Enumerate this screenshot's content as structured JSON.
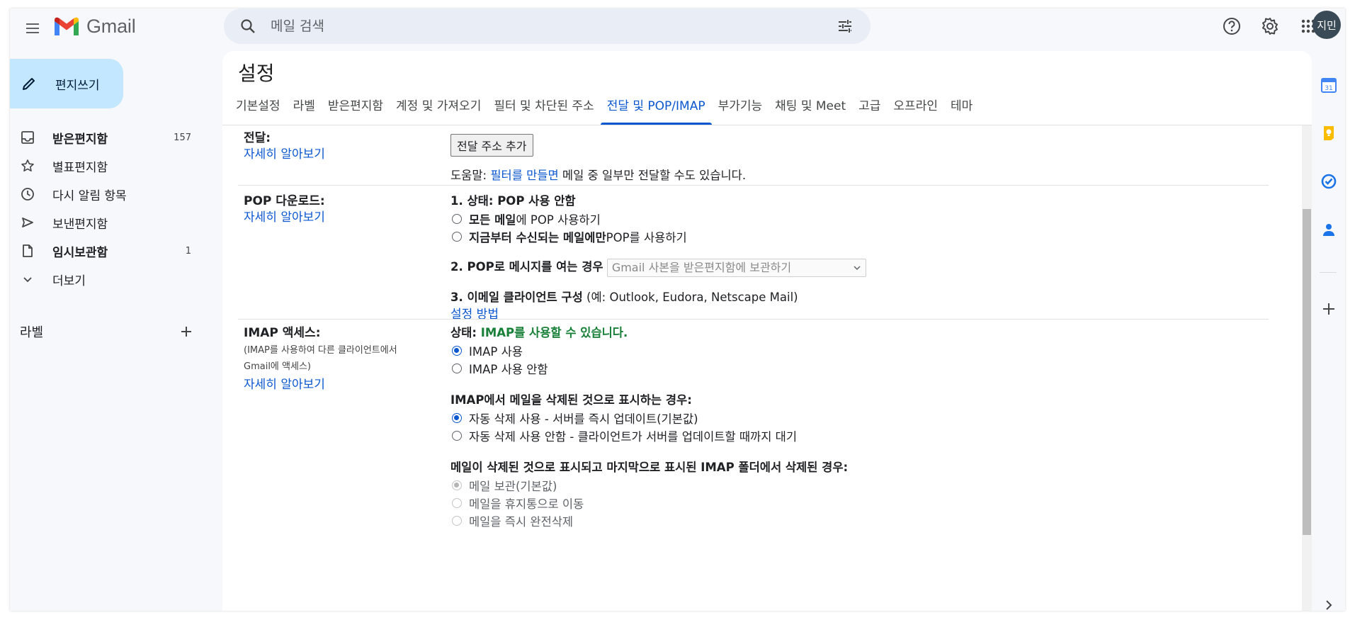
{
  "header": {
    "app_name": "Gmail",
    "search_placeholder": "메일 검색",
    "avatar_text": "지민"
  },
  "sidebar": {
    "compose_label": "편지쓰기",
    "items": [
      {
        "label": "받은편지함",
        "count": "157",
        "icon": "inbox-icon",
        "bold": true
      },
      {
        "label": "별표편지함",
        "count": "",
        "icon": "star-icon",
        "bold": false
      },
      {
        "label": "다시 알림 항목",
        "count": "",
        "icon": "clock-icon",
        "bold": false
      },
      {
        "label": "보낸편지함",
        "count": "",
        "icon": "send-icon",
        "bold": false
      },
      {
        "label": "임시보관함",
        "count": "1",
        "icon": "draft-icon",
        "bold": true
      },
      {
        "label": "더보기",
        "count": "",
        "icon": "chevron-down-icon",
        "bold": false
      }
    ],
    "labels_title": "라벨"
  },
  "main": {
    "title": "설정",
    "tabs": [
      "기본설정",
      "라벨",
      "받은편지함",
      "계정 및 가져오기",
      "필터 및 차단된 주소",
      "전달 및 POP/IMAP",
      "부가기능",
      "채팅 및 Meet",
      "고급",
      "오프라인",
      "테마"
    ],
    "active_tab": "전달 및 POP/IMAP"
  },
  "forwarding": {
    "title": "전달:",
    "learn_more": "자세히 알아보기",
    "add_button": "전달 주소 추가",
    "tip_prefix": "도움말: ",
    "tip_link": "필터를 만들면",
    "tip_suffix": " 메일 중 일부만 전달할 수도 있습니다."
  },
  "pop": {
    "title": "POP 다운로드:",
    "learn_more": "자세히 알아보기",
    "status_line": "1. 상태: POP 사용 안함",
    "opt1_bold": "모든 메일",
    "opt1_rest": "에 POP 사용하기",
    "opt2_bold": "지금부터 수신되는 메일에만",
    "opt2_rest": " POP를 사용하기",
    "step2_label": "2. POP로 메시지를 여는 경우",
    "step2_select": "Gmail 사본을 받은편지함에 보관하기",
    "step3_label": "3. 이메일 클라이언트 구성",
    "step3_examples": " (예: Outlook, Eudora, Netscape Mail)",
    "setup_link": "설정 방법"
  },
  "imap": {
    "title": "IMAP 액세스:",
    "note1": "(IMAP를 사용하여 다른 클라이언트에서",
    "note2": "Gmail에 액세스)",
    "learn_more": "자세히 알아보기",
    "status_label": "상태: ",
    "status_value": "IMAP를 사용할 수 있습니다.",
    "enable": "IMAP 사용",
    "disable": "IMAP 사용 안함",
    "delete_heading": "IMAP에서 메일을 삭제된 것으로 표시하는 경우:",
    "auto_on": "자동 삭제 사용 - 서버를 즉시 업데이트(기본값)",
    "auto_off": "자동 삭제 사용 안함 - 클라이언트가 서버를 업데이트할 때까지 대기",
    "expunge_heading": "메일이 삭제된 것으로 표시되고 마지막으로 표시된 IMAP 폴더에서 삭제된 경우:",
    "keep": "메일 보관(기본값)",
    "trash": "메일을 휴지통으로 이동",
    "delete_forever": "메일을 즉시 완전삭제"
  },
  "colors": {
    "accent": "#0b57d0",
    "compose_bg": "#c2e7ff",
    "status_green": "#188038"
  }
}
